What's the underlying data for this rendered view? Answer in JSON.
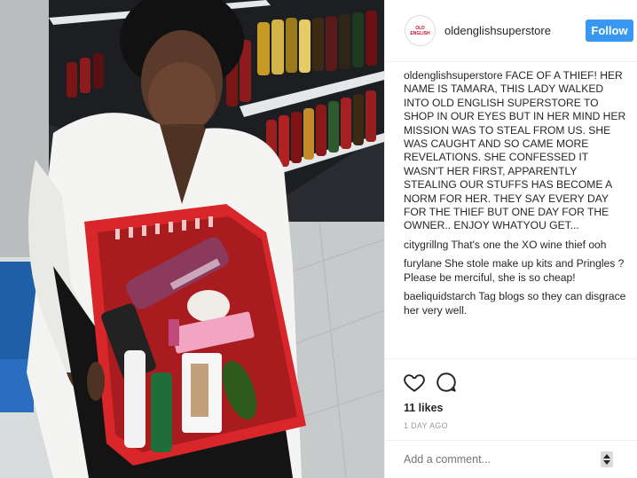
{
  "post": {
    "username": "oldenglishsuperstore",
    "avatar_logo_line1": "OLD",
    "avatar_logo_line2": "ENGLISH",
    "follow_label": "Follow",
    "caption": "FACE OF A THIEF! HER NAME IS TAMARA, THIS LADY WALKED INTO OLD ENGLISH SUPERSTORE TO SHOP IN OUR EYES BUT IN HER MIND HER MISSION WAS TO STEAL FROM US. SHE WAS CAUGHT AND SO CAME MORE REVELATIONS. SHE CONFESSED IT WASN'T HER FIRST, APPARENTLY STEALING OUR STUFFS HAS BECOME A NORM FOR HER. THEY SAY EVERY DAY FOR THE THIEF BUT ONE DAY FOR THE OWNER.. ENJOY WHATYOU GET...",
    "likes": "11 likes",
    "time": "1 DAY AGO",
    "add_comment_placeholder": "Add a comment..."
  },
  "comments": [
    {
      "user": "citygrillng",
      "text": "That's one the XO wine thief ooh"
    },
    {
      "user": "furylane",
      "text": "She stole make up kits and Pringles ? Please be merciful, she is so cheap!"
    },
    {
      "user": "baeliquidstarch",
      "text": "Tag blogs so they can disgrace her very well."
    }
  ],
  "icons": {
    "like": "heart-icon",
    "comment": "comment-icon",
    "more": "more-options-icon"
  },
  "colors": {
    "follow": "#3897f0",
    "basket": "#d8262b",
    "text": "#262626",
    "muted": "#999999"
  }
}
